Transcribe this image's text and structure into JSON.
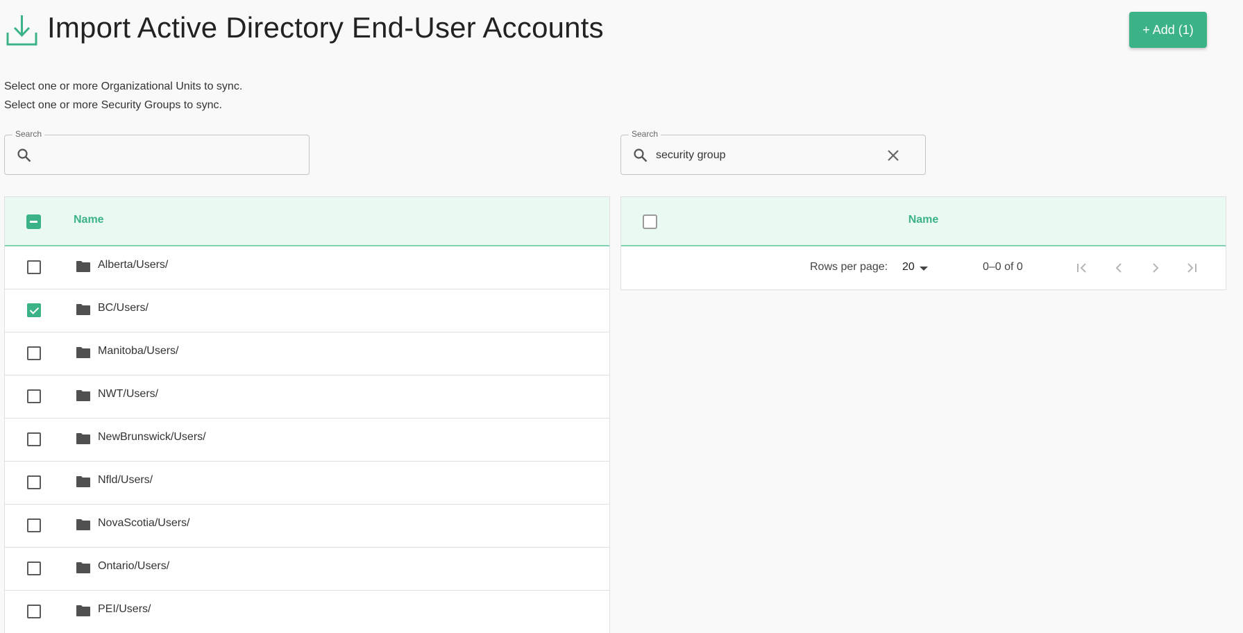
{
  "header": {
    "title": "Import Active Directory End-User Accounts",
    "add_button": "+ Add (1)"
  },
  "descriptions": {
    "ou": "Select one or more Organizational Units to sync.",
    "groups": "Select one or more Security Groups to sync."
  },
  "left_search": {
    "legend": "Search",
    "value": ""
  },
  "right_search": {
    "legend": "Search",
    "value": "security group"
  },
  "left_table": {
    "header": {
      "name": "Name",
      "select_all_state": "indeterminate"
    },
    "rows": [
      {
        "label": "Alberta/Users/",
        "checked": false
      },
      {
        "label": "BC/Users/",
        "checked": true
      },
      {
        "label": "Manitoba/Users/",
        "checked": false
      },
      {
        "label": "NWT/Users/",
        "checked": false
      },
      {
        "label": "NewBrunswick/Users/",
        "checked": false
      },
      {
        "label": "Nfld/Users/",
        "checked": false
      },
      {
        "label": "NovaScotia/Users/",
        "checked": false
      },
      {
        "label": "Ontario/Users/",
        "checked": false
      },
      {
        "label": "PEI/Users/",
        "checked": false
      }
    ]
  },
  "right_table": {
    "header": {
      "name": "Name",
      "select_all_state": "unchecked"
    },
    "pagination": {
      "rows_per_page_label": "Rows per page:",
      "rows_per_page": "20",
      "range": "0–0 of 0"
    }
  },
  "colors": {
    "accent": "#3cb387",
    "header_bg": "#eafaf3",
    "icon": "#555555"
  }
}
